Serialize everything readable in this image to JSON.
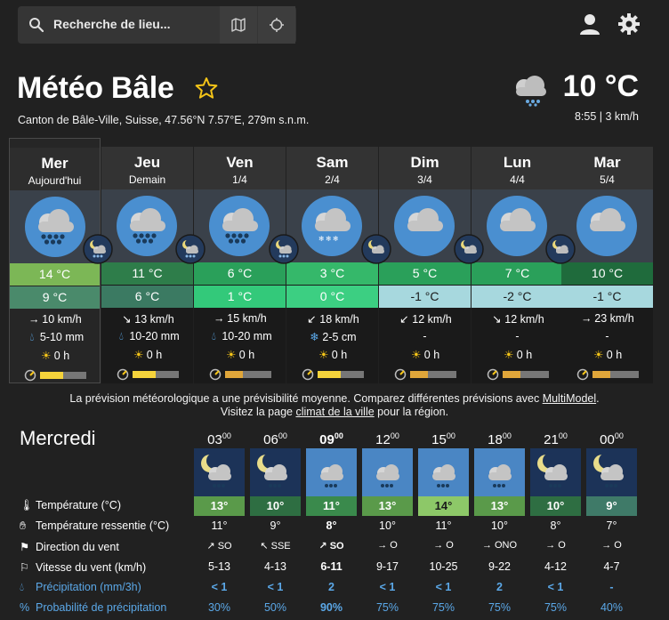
{
  "search": {
    "placeholder": "Recherche de lieu..."
  },
  "location": {
    "title": "Météo Bâle",
    "subtitle": "Canton de Bâle-Ville, Suisse, 47.56°N 7.57°E, 279m s.n.m."
  },
  "current": {
    "temp": "10 °C",
    "meta": "8:55 | 3 km/h"
  },
  "days": [
    {
      "name": "Mer",
      "date": "Aujourd'hui",
      "tmax": "14 °C",
      "tmin": "9 °C",
      "wind_arrow": "→",
      "wind": "10 km/h",
      "precip_icon": "drop",
      "precip": "5-10 mm",
      "sun": "0 h",
      "predict": 0.5,
      "tmax_color": "#7cb756",
      "tmin_color": "#4a8a6b",
      "icon": "rain"
    },
    {
      "name": "Jeu",
      "date": "Demain",
      "tmax": "11 °C",
      "tmin": "6 °C",
      "wind_arrow": "↘",
      "wind": "13 km/h",
      "precip_icon": "drop",
      "precip": "10-20 mm",
      "sun": "0 h",
      "predict": 0.5,
      "tmax_color": "#2e7d4a",
      "tmin_color": "#3b7a62",
      "icon": "rain"
    },
    {
      "name": "Ven",
      "date": "1/4",
      "tmax": "6 °C",
      "tmin": "1 °C",
      "wind_arrow": "→",
      "wind": "15 km/h",
      "precip_icon": "drop",
      "precip": "10-20 mm",
      "sun": "0 h",
      "predict": 0.4,
      "tmax_color": "#2aa05a",
      "tmin_color": "#33c97a",
      "icon": "rain"
    },
    {
      "name": "Sam",
      "date": "2/4",
      "tmax": "3 °C",
      "tmin": "0 °C",
      "wind_arrow": "↙",
      "wind": "18 km/h",
      "precip_icon": "snow",
      "precip": "2-5 cm",
      "sun": "0 h",
      "predict": 0.5,
      "tmax_color": "#35b86a",
      "tmin_color": "#3ccf82",
      "icon": "snow"
    },
    {
      "name": "Dim",
      "date": "3/4",
      "tmax": "5 °C",
      "tmin": "-1 °C",
      "wind_arrow": "↙",
      "wind": "12 km/h",
      "precip_icon": "none",
      "precip": "-",
      "sun": "0 h",
      "predict": 0.4,
      "tmax_color": "#2aa05a",
      "tmin_color": "#a7d8de",
      "icon": "cloud"
    },
    {
      "name": "Lun",
      "date": "4/4",
      "tmax": "7 °C",
      "tmin": "-2 °C",
      "wind_arrow": "↘",
      "wind": "12 km/h",
      "precip_icon": "none",
      "precip": "-",
      "sun": "0 h",
      "predict": 0.4,
      "tmax_color": "#2aa05a",
      "tmin_color": "#a7d8de",
      "icon": "cloud"
    },
    {
      "name": "Mar",
      "date": "5/4",
      "tmax": "10 °C",
      "tmin": "-1 °C",
      "wind_arrow": "→",
      "wind": "23 km/h",
      "precip_icon": "none",
      "precip": "-",
      "sun": "0 h",
      "predict": 0.4,
      "tmax_color": "#1f6b3c",
      "tmin_color": "#a7d8de",
      "icon": "cloud"
    }
  ],
  "notice": {
    "line1_a": "La prévision météorologique a une prévisibilité moyenne. Comparez différentes prévisions avec ",
    "line1_link": "MultiModel",
    "line1_b": ".",
    "line2_a": "Visitez la page ",
    "line2_link": "climat de la ville",
    "line2_b": " pour la région."
  },
  "hourly": {
    "title": "Mercredi",
    "row_labels": {
      "temp": "Température (°C)",
      "feels": "Température ressentie (°C)",
      "wind_dir": "Direction du vent",
      "wind_speed": "Vitesse du vent (km/h)",
      "precip": "Précipitation (mm/3h)",
      "prob": "Probabilité de précipitation"
    },
    "hours": [
      {
        "h": "03",
        "m": "00",
        "temp": "13°",
        "feels": "11°",
        "dir_arrow": "↗",
        "dir": "SO",
        "speed": "5-13",
        "precip": "< 1",
        "prob": "30%",
        "color": "#5a9a4a",
        "night": true,
        "bold": false
      },
      {
        "h": "06",
        "m": "00",
        "temp": "10°",
        "feels": "9°",
        "dir_arrow": "↖",
        "dir": "SSE",
        "speed": "4-13",
        "precip": "< 1",
        "prob": "50%",
        "color": "#2e6e42",
        "night": true,
        "bold": false
      },
      {
        "h": "09",
        "m": "00",
        "temp": "11°",
        "feels": "8°",
        "dir_arrow": "↗",
        "dir": "SO",
        "speed": "6-11",
        "precip": "2",
        "prob": "90%",
        "color": "#3a8a4c",
        "night": false,
        "bold": true
      },
      {
        "h": "12",
        "m": "00",
        "temp": "13°",
        "feels": "10°",
        "dir_arrow": "→",
        "dir": "O",
        "speed": "9-17",
        "precip": "< 1",
        "prob": "75%",
        "color": "#5a9a4a",
        "night": false,
        "bold": false
      },
      {
        "h": "15",
        "m": "00",
        "temp": "14°",
        "feels": "11°",
        "dir_arrow": "→",
        "dir": "O",
        "speed": "10-25",
        "precip": "< 1",
        "prob": "75%",
        "color": "#8dc868",
        "night": false,
        "bold": false
      },
      {
        "h": "18",
        "m": "00",
        "temp": "13°",
        "feels": "10°",
        "dir_arrow": "→",
        "dir": "ONO",
        "speed": "9-22",
        "precip": "2",
        "prob": "75%",
        "color": "#5a9a4a",
        "night": false,
        "bold": false
      },
      {
        "h": "21",
        "m": "00",
        "temp": "10°",
        "feels": "8°",
        "dir_arrow": "→",
        "dir": "O",
        "speed": "4-12",
        "precip": "< 1",
        "prob": "75%",
        "color": "#2e6e42",
        "night": true,
        "bold": false
      },
      {
        "h": "00",
        "m": "00",
        "temp": "9°",
        "feels": "7°",
        "dir_arrow": "→",
        "dir": "O",
        "speed": "4-7",
        "precip": "-",
        "prob": "40%",
        "color": "#3f7a68",
        "night": true,
        "bold": false
      }
    ]
  },
  "colors": {
    "accent_blue": "#5ba8e8",
    "star": "#f5c518",
    "sky_day": "#3a414a",
    "sun_bar": "#f5d33b"
  }
}
